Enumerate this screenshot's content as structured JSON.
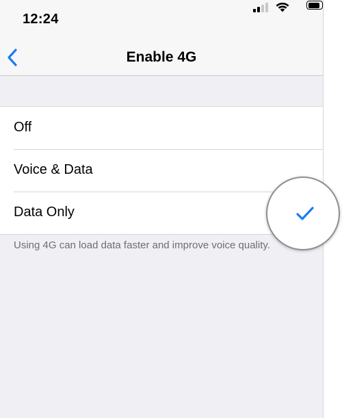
{
  "status_bar": {
    "time": "12:24",
    "signal_icon": "cellular-signal-icon",
    "wifi_icon": "wifi-icon",
    "battery_icon": "battery-icon"
  },
  "nav": {
    "back_icon": "chevron-left-icon",
    "title": "Enable 4G"
  },
  "options": [
    {
      "label": "Off",
      "selected": false
    },
    {
      "label": "Voice & Data",
      "selected": false
    },
    {
      "label": "Data Only",
      "selected": true
    }
  ],
  "footer_note": "Using 4G can load data faster and improve voice quality.",
  "colors": {
    "accent": "#1a7cf5",
    "background": "#efeff4",
    "row_background": "#ffffff",
    "separator": "#d6d6da",
    "footer_text": "#6d6d72"
  }
}
